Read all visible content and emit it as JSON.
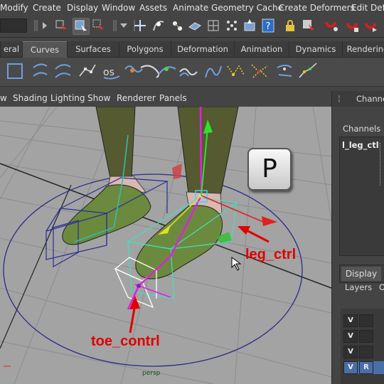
{
  "menu": [
    "Modify",
    "Create",
    "Display",
    "Window",
    "Assets",
    "Animate",
    "Geometry Cache",
    "Create Deformers",
    "Edit Defo"
  ],
  "shelf_tabs": [
    "eral",
    "Curves",
    "Surfaces",
    "Polygons",
    "Deformation",
    "Animation",
    "Dynamics",
    "Rendering"
  ],
  "active_shelf_tab": "Curves",
  "panel_menu": [
    "w",
    "Shading",
    "Lighting",
    "Show",
    "Renderer",
    "Panels"
  ],
  "viewport": {
    "camera_label": "persp",
    "key_overlay": "P",
    "annotations": {
      "leg": "leg_ctrl",
      "toe": "toe_contrl"
    }
  },
  "channel_box": {
    "header": "Channel",
    "channels_label": "Channels",
    "object_name": "l_leg_ctl"
  },
  "layer_editor": {
    "tab": "Display",
    "layers_menu": "Layers",
    "layers_menu2": "O",
    "rows": [
      {
        "v": "V",
        "r": ""
      },
      {
        "v": "V",
        "r": ""
      },
      {
        "v": "V",
        "r": ""
      },
      {
        "v": "V",
        "r": "R"
      }
    ]
  },
  "colors": {
    "accent_red": "#e00000",
    "viewport_bg": "#a3a3a3",
    "ui_bg": "#444444"
  }
}
